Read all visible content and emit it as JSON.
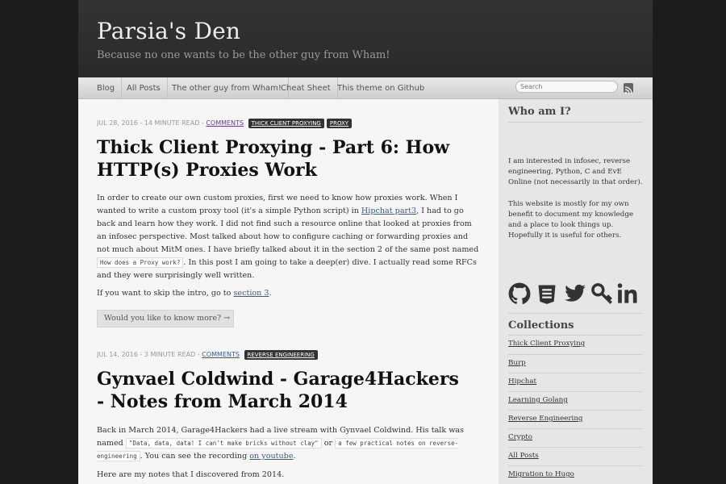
{
  "header": {
    "title": "Parsia's Den",
    "tagline": "Because no one wants to be the other guy from Wham!"
  },
  "nav": {
    "items": [
      "Blog",
      "All Posts",
      "The other guy from Wham!",
      "Cheat Sheet",
      "This theme on Github"
    ],
    "search_placeholder": "Search"
  },
  "posts": [
    {
      "meta": "JUL 28, 2016 - 14 MINUTE READ -",
      "comments": "COMMENTS",
      "tags": [
        "THICK CLIENT PROXYING",
        "PROXY"
      ],
      "title": "Thick Client Proxying - Part 6: How HTTP(s) Proxies Work",
      "p1_a": "In order to create our own custom proxies, first we need to know how proxies work. When I wanted to write a custom proxy tool (it's a simple Python script) in ",
      "p1_link": "Hipchat part3",
      "p1_b": ", I had to go back and learn how they work. I did not find such a resource online that looked at proxies from an infosec perspective. Most talked about how to configure caching or forwarding proxies and not much about MitM ones. I have briefly talked about it in the section 2 of the same post named ",
      "p1_code": "How does a Proxy work?",
      "p1_c": ". In this post I am going to take a deep(er) dive. I actually read some RFCs and they were surprisingly well written.",
      "p2_a": "If you want to skip the intro, go to ",
      "p2_link": "section 3",
      "p2_b": ".",
      "more": "Would you like to know more? →"
    },
    {
      "meta": "JUL 14, 2016 - 3 MINUTE READ -",
      "comments": "COMMENTS",
      "tags": [
        "REVERSE ENGINEERING"
      ],
      "title": "Gynvael Coldwind - Garage4Hackers - Notes from March 2014",
      "p1_a": "Back in March 2014, Garage4Hackers had a live stream with Gynvael Coldwind. His talk was named ",
      "p1_code1": "\"Data, data, data! I can't make bricks without clay\"",
      "p1_b": " or ",
      "p1_code2": "a few practical notes on reverse-engineering",
      "p1_c": ". You can see the recording ",
      "p1_link": "on youtube",
      "p1_d": ".",
      "p2": "Here are my notes that I discovered from 2014."
    }
  ],
  "sidebar": {
    "about_title": "Who am I?",
    "about_p1": "I am interested in infosec, reverse engineering, Python, C and EvE Online (not necessarily in that order).",
    "about_p2": "This website is mostly for my own benefit to document my knowledge and a place to look things up. Hopefully it is useful for others.",
    "social_icons": [
      "github-icon",
      "stack-icon",
      "twitter-icon",
      "keybase-icon",
      "linkedin-icon"
    ],
    "collections_title": "Collections",
    "collections": [
      "Thick Client Proxying",
      "Burp",
      "Hipchat",
      "Learning Golang",
      "Reverse Engineering",
      "Crypto",
      "All Posts",
      "Migration to Hugo"
    ]
  },
  "colors": {
    "background": "#1c1c1c",
    "page": "#f6f6f6",
    "sidebar": "#e6e6e6",
    "link": "#2a5fa0",
    "tag": "#333333"
  }
}
